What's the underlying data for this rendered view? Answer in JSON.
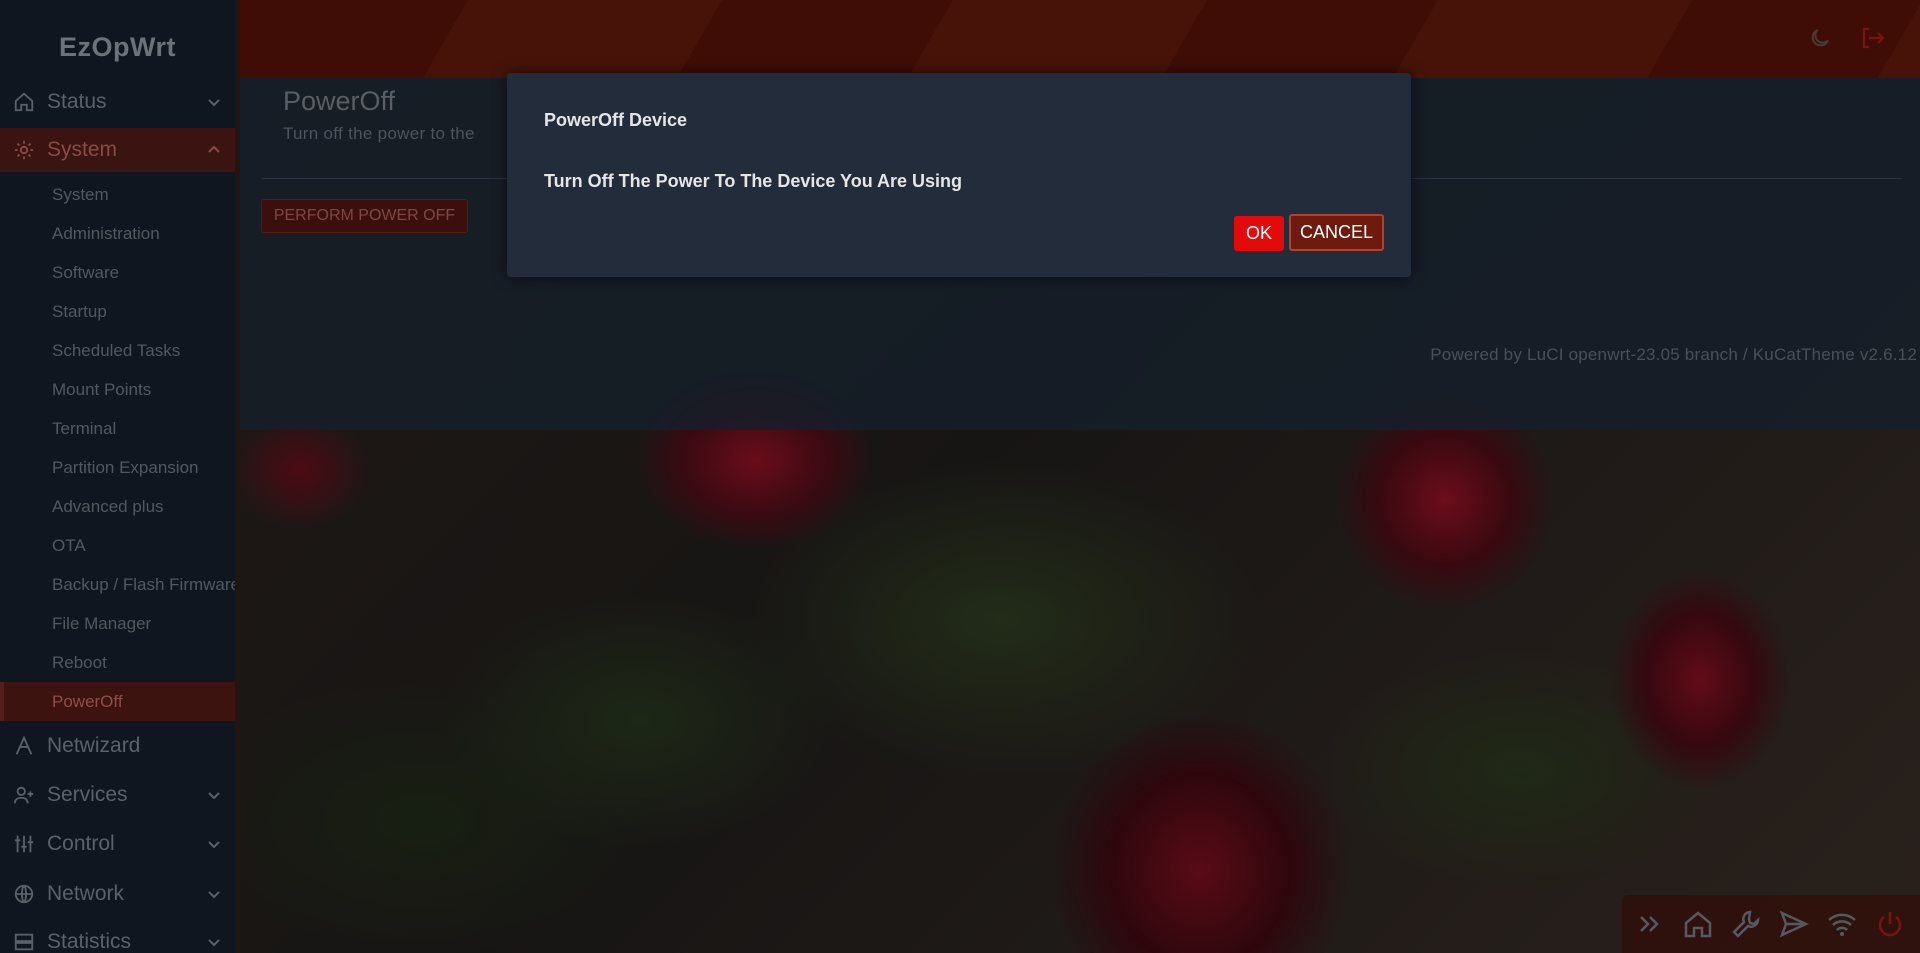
{
  "brand": "EzOpWrt",
  "sidebar": {
    "top_items": [
      {
        "label": "Status",
        "icon": "home-icon"
      },
      {
        "label": "System",
        "icon": "gear-icon"
      },
      {
        "label": "Netwizard",
        "icon": "wizard-icon"
      },
      {
        "label": "Services",
        "icon": "user-plus-icon"
      },
      {
        "label": "Control",
        "icon": "sliders-icon"
      },
      {
        "label": "Network",
        "icon": "globe-icon"
      },
      {
        "label": "Statistics",
        "icon": "server-icon"
      }
    ],
    "system_items": [
      "System",
      "Administration",
      "Software",
      "Startup",
      "Scheduled Tasks",
      "Mount Points",
      "Terminal",
      "Partition Expansion",
      "Advanced plus",
      "OTA",
      "Backup / Flash Firmware",
      "File Manager",
      "Reboot",
      "PowerOff"
    ],
    "active_section": "System",
    "active_item": "PowerOff"
  },
  "page": {
    "title": "PowerOff",
    "description": "Turn off the power to the",
    "perform_button": "PERFORM POWER OFF",
    "footer": "Powered by LuCI openwrt-23.05 branch / KuCatTheme v2.6.12"
  },
  "modal": {
    "title": "PowerOff Device",
    "body": "Turn Off The Power To The Device You Are Using",
    "ok_label": "OK",
    "cancel_label": "CANCEL"
  },
  "header_icons": [
    "moon-icon",
    "logout-icon"
  ],
  "dock_icons": [
    "double-chevron-right-icon",
    "home-icon",
    "wrench-icon",
    "send-icon",
    "wifi-icon",
    "power-icon"
  ],
  "colors": {
    "accent": "#e50a0a",
    "cancel_bg": "#6e1a0f",
    "modal_bg": "#222c3a",
    "sidebar_bg": "#0f1620"
  }
}
